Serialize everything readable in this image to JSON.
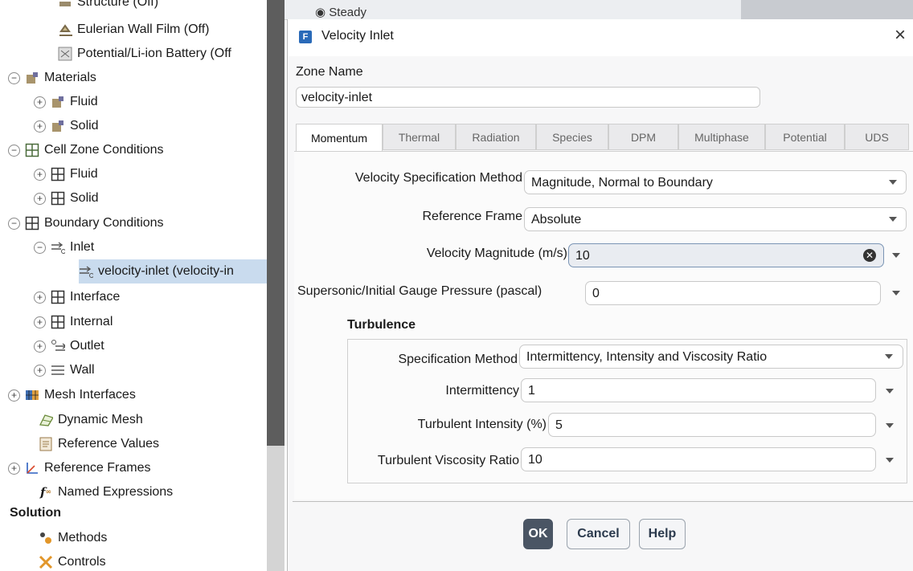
{
  "tree": {
    "items": [
      {
        "label": "Structure (Off)",
        "toggle": "",
        "icon": "structure-icon"
      },
      {
        "label": "Eulerian Wall Film (Off)",
        "toggle": "",
        "icon": "wall-film-icon"
      },
      {
        "label": "Potential/Li-ion Battery (Off",
        "toggle": "",
        "icon": "battery-icon"
      },
      {
        "label": "Materials",
        "toggle": "−",
        "icon": "materials-icon"
      },
      {
        "label": "Fluid",
        "toggle": "+",
        "icon": "materials-icon"
      },
      {
        "label": "Solid",
        "toggle": "+",
        "icon": "materials-icon"
      },
      {
        "label": "Cell Zone Conditions",
        "toggle": "−",
        "icon": "grid-icon"
      },
      {
        "label": "Fluid",
        "toggle": "+",
        "icon": "grid-icon"
      },
      {
        "label": "Solid",
        "toggle": "+",
        "icon": "grid-icon"
      },
      {
        "label": "Boundary Conditions",
        "toggle": "−",
        "icon": "grid-icon"
      },
      {
        "label": "Inlet",
        "toggle": "−",
        "icon": "inlet-icon"
      },
      {
        "label": "velocity-inlet (velocity-in",
        "toggle": "",
        "icon": "inlet-icon"
      },
      {
        "label": "Interface",
        "toggle": "+",
        "icon": "grid-icon"
      },
      {
        "label": "Internal",
        "toggle": "+",
        "icon": "grid-icon"
      },
      {
        "label": "Outlet",
        "toggle": "+",
        "icon": "outlet-icon"
      },
      {
        "label": "Wall",
        "toggle": "+",
        "icon": "wall-icon"
      },
      {
        "label": "Mesh Interfaces",
        "toggle": "+",
        "icon": "mesh-interfaces-icon"
      },
      {
        "label": "Dynamic Mesh",
        "toggle": "",
        "icon": "dynamic-mesh-icon"
      },
      {
        "label": "Reference Values",
        "toggle": "",
        "icon": "reference-values-icon"
      },
      {
        "label": "Reference Frames",
        "toggle": "+",
        "icon": "axes-icon"
      },
      {
        "label": "Named Expressions",
        "toggle": "",
        "icon": "function-icon"
      },
      {
        "label": "Solution",
        "toggle": "",
        "icon": ""
      },
      {
        "label": "Methods",
        "toggle": "",
        "icon": "methods-icon"
      },
      {
        "label": "Controls",
        "toggle": "",
        "icon": "controls-icon"
      }
    ]
  },
  "background": {
    "radio_label": "Steady"
  },
  "dialog": {
    "title": "Velocity Inlet",
    "logo": "F",
    "zone_name_label": "Zone Name",
    "zone_name_value": "velocity-inlet",
    "tabs": [
      "Momentum",
      "Thermal",
      "Radiation",
      "Species",
      "DPM",
      "Multiphase",
      "Potential",
      "UDS"
    ],
    "active_tab": "Momentum",
    "fields": {
      "velocity_spec_label": "Velocity Specification Method",
      "velocity_spec_value": "Magnitude, Normal to Boundary",
      "ref_frame_label": "Reference Frame",
      "ref_frame_value": "Absolute",
      "vel_mag_label": "Velocity Magnitude (m/s)",
      "vel_mag_value": "10",
      "gauge_label": "Supersonic/Initial Gauge Pressure (pascal)",
      "gauge_value": "0"
    },
    "turbulence": {
      "title": "Turbulence",
      "spec_label": "Specification Method",
      "spec_value": "Intermittency, Intensity and Viscosity Ratio",
      "intermittency_label": "Intermittency",
      "intermittency_value": "1",
      "intensity_label": "Turbulent Intensity (%)",
      "intensity_value": "5",
      "visc_ratio_label": "Turbulent Viscosity Ratio",
      "visc_ratio_value": "10"
    },
    "buttons": {
      "ok": "OK",
      "cancel": "Cancel",
      "help": "Help"
    }
  }
}
